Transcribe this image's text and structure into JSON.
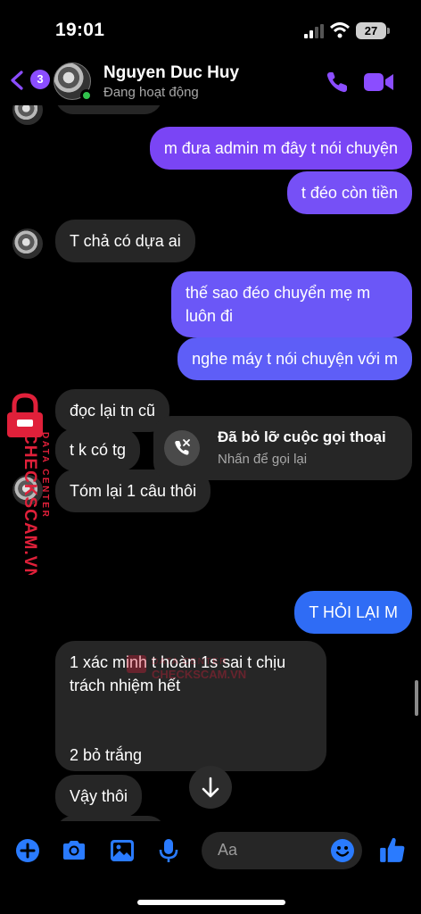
{
  "status_bar": {
    "time": "19:01",
    "battery": "27"
  },
  "header": {
    "back_badge": "3",
    "contact_name": "Nguyen Duc Huy",
    "contact_status": "Đang hoạt động"
  },
  "messages": [
    {
      "dir": "out",
      "text": "m đưa admin m đây t nói chuyện"
    },
    {
      "dir": "out",
      "text": "t đéo còn tiền"
    },
    {
      "dir": "in",
      "text": "T chả có dựa ai"
    },
    {
      "dir": "out",
      "text": "thế sao đéo chuyển mẹ m luôn đi"
    },
    {
      "dir": "out",
      "text": "nghe máy t nói chuyện với m"
    },
    {
      "dir": "in",
      "text": "đọc lại tn cũ"
    },
    {
      "dir": "in",
      "text": "t k có tg"
    },
    {
      "dir": "in",
      "text": "Tóm lại 1 câu thôi"
    },
    {
      "dir": "out",
      "text": "T HỎI LẠI M"
    },
    {
      "dir": "in",
      "text": "1 xác minh t hoàn 1s sai t chịu trách nhiệm hết\n\n\n2 bỏ trắng"
    },
    {
      "dir": "in",
      "text": "Vậy thôi"
    }
  ],
  "missed_call": {
    "title": "Đã bỏ lỡ cuộc gọi thoại",
    "subtitle": "Nhấn để gọi lại"
  },
  "composer": {
    "placeholder": "Aa"
  },
  "watermark": {
    "line1": "DATA CENTER",
    "line2": "CHECKSCAM.VN"
  },
  "colors": {
    "accent": "#8b4dff",
    "incoming_bubble": "#262626",
    "composer_icon": "#2a7bff",
    "online": "#31c24d",
    "watermark": "#e0203a"
  },
  "icons": [
    "back-chevron-icon",
    "phone-icon",
    "video-camera-icon",
    "plus-icon",
    "camera-icon",
    "image-icon",
    "microphone-icon",
    "emoji-icon",
    "thumbs-up-icon",
    "arrow-down-icon",
    "missed-call-icon",
    "lock-icon"
  ]
}
